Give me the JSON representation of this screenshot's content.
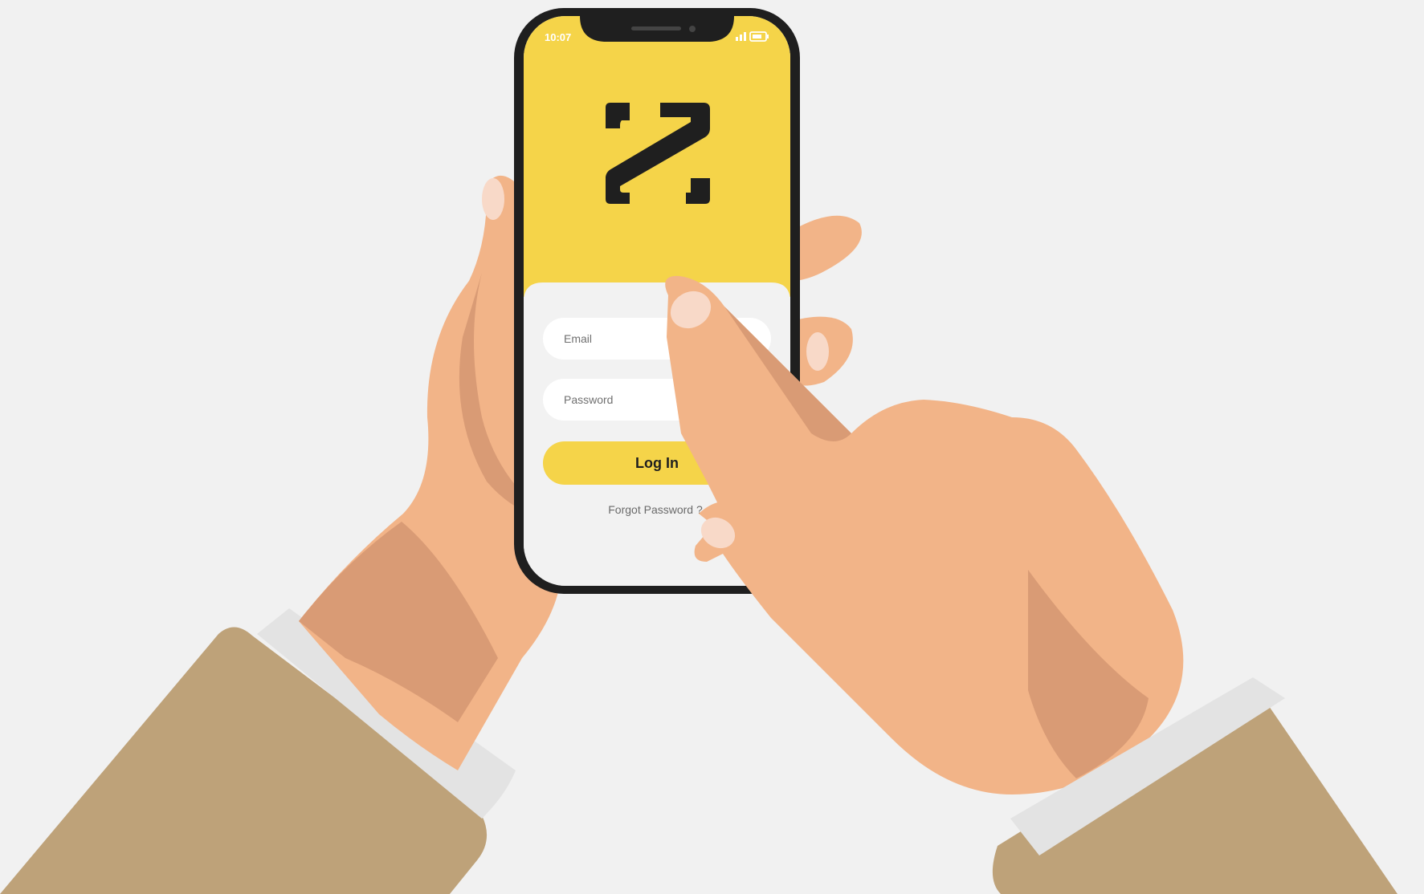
{
  "status_bar": {
    "time": "10:07",
    "icons": [
      "signal-icon",
      "battery-icon"
    ]
  },
  "app": {
    "logo_icon": "logo-mark-icon",
    "accent_color": "#f5d449",
    "form_background": "#f2f2f2"
  },
  "login_form": {
    "email_placeholder": "Email",
    "password_placeholder": "Password",
    "login_label": "Log In",
    "forgot_label": "Forgot Password ?"
  }
}
